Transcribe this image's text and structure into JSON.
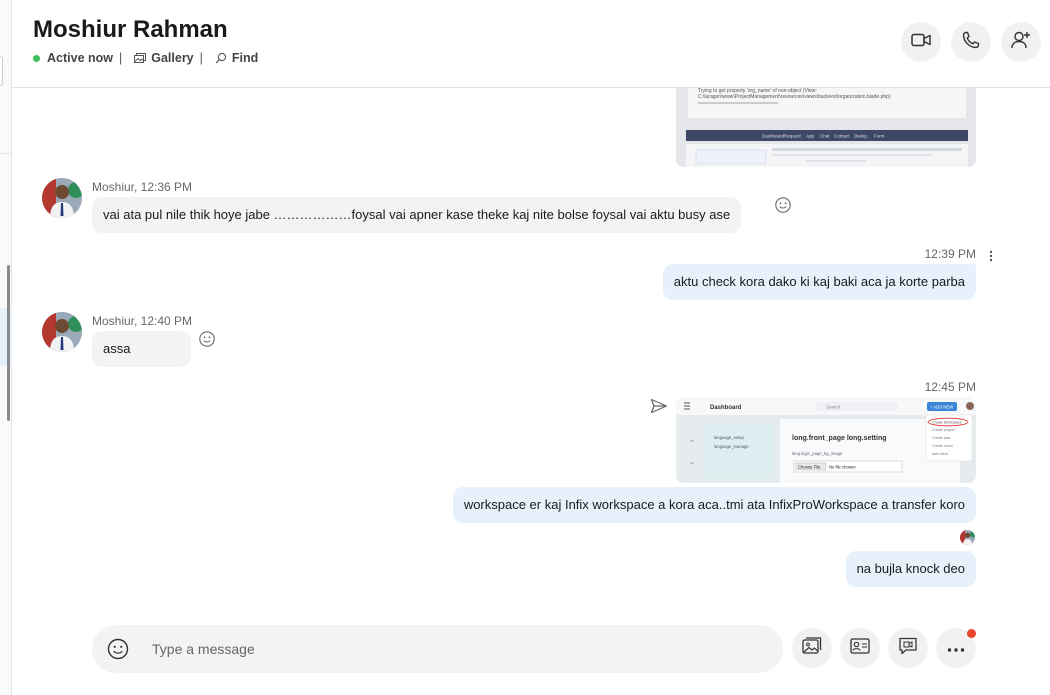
{
  "header": {
    "title": "Moshiur Rahman",
    "status": "Active now",
    "gallery": "Gallery",
    "find": "Find"
  },
  "messages": [
    {
      "kind": "image-out"
    },
    {
      "kind": "in",
      "sender_time": "Moshiur, 12:36 PM",
      "text": "vai ata pul nile thik hoye jabe ………………foysal vai apner kase theke kaj nite bolse  foysal vai aktu busy ase"
    },
    {
      "kind": "out",
      "time": "12:39 PM",
      "text": "aktu check kora dako ki kaj baki aca ja korte parba"
    },
    {
      "kind": "in",
      "sender_time": "Moshiur, 12:40 PM",
      "text": "assa"
    },
    {
      "kind": "image-out",
      "time": "12:45 PM"
    },
    {
      "kind": "out",
      "text": "workspace er kaj Infix workspace a kora aca..tmi ata InfixProWorkspace a transfer koro"
    },
    {
      "kind": "out",
      "text": "na bujla knock deo"
    }
  ],
  "thumb1": {
    "line1": "Trying to get property 'org_name' of non-object (View:",
    "line2": "C:\\laragon\\www\\ProjectManagement\\resources\\views\\backend\\organization.blade.php)",
    "nav": [
      "Dashboard",
      "Request",
      "App",
      "Chat",
      "Contact",
      "Dialog",
      "Form"
    ]
  },
  "thumb2": {
    "dashboard": "Dashboard",
    "search": "Search",
    "add_new": "+ ADD NEW",
    "menu_items": [
      "language_setup",
      "language_manage"
    ],
    "heading": "long.front_page long.setting",
    "sub": "lang.login_page_bg_image",
    "choose": "Choose File",
    "nofile": "No file chosen",
    "dropdown": [
      "Create Workspace",
      "Create project",
      "Create task",
      "Create event",
      "Add client"
    ]
  },
  "composer": {
    "placeholder": "Type a message"
  },
  "colors": {
    "online": "#3fbf5d",
    "out_bubble": "#e6f1fb",
    "in_bubble": "#f1f3f5",
    "notification": "#e8442e"
  }
}
